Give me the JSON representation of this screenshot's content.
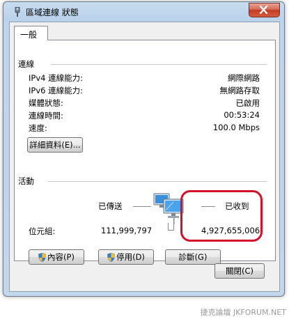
{
  "window": {
    "title": "區域連線 狀態"
  },
  "tabs": [
    {
      "label": "一般"
    }
  ],
  "connection": {
    "heading": "連線",
    "rows": [
      {
        "label": "IPv4 連線能力:",
        "value": "網際網路"
      },
      {
        "label": "IPv6 連線能力:",
        "value": "無網路存取"
      },
      {
        "label": "媒體狀態:",
        "value": "已啟用"
      },
      {
        "label": "連線時間:",
        "value": "00:53:24"
      },
      {
        "label": "速度:",
        "value": "100.0 Mbps"
      }
    ],
    "details_button": "詳細資料(E)..."
  },
  "activity": {
    "heading": "活動",
    "sent_label": "已傳送",
    "received_label": "已收到",
    "bytes_label": "位元組:",
    "bytes_sent": "111,999,797",
    "bytes_received": "4,927,655,006"
  },
  "buttons": {
    "properties": "內容(P)",
    "disable": "停用(D)",
    "diagnose": "診斷(G)",
    "close": "關閉(C)"
  },
  "watermark": "捷克論壇 JKFORUM.NET",
  "colors": {
    "annotation_circle": "#d4112a",
    "title_bar": "#b9d1ea"
  },
  "icons": [
    "network-adapter-icon",
    "close-icon",
    "uac-shield-icon",
    "network-computers-icon"
  ]
}
